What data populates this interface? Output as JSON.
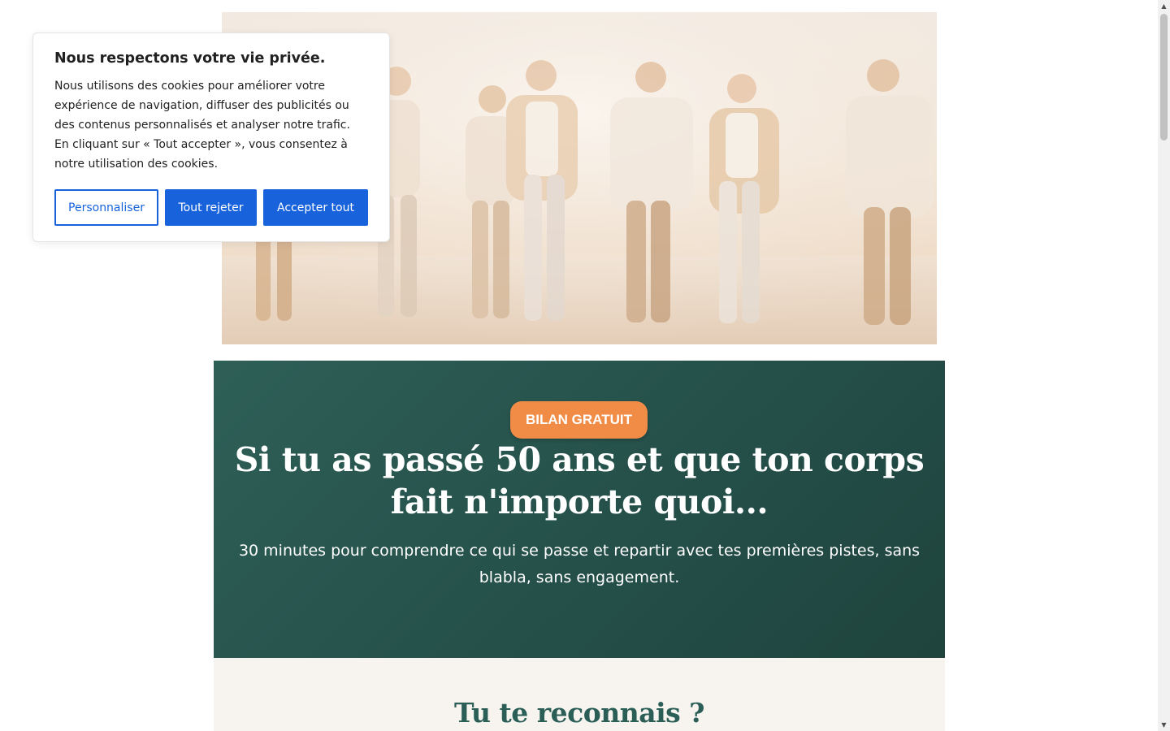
{
  "cookie_banner": {
    "title": "Nous respectons votre vie privée.",
    "text": "Nous utilisons des cookies pour améliorer votre expérience de navigation, diffuser des publicités ou des contenus personnalisés et analyser notre trafic. En cliquant sur « Tout accepter », vous consentez à notre utilisation des cookies.",
    "customize_label": "Personnaliser",
    "reject_label": "Tout rejeter",
    "accept_label": "Accepter tout"
  },
  "hero": {
    "image_description_icon": "photo-group-of-seniors-walking"
  },
  "banner": {
    "badge": "BILAN GRATUIT",
    "headline": "Si tu as passé 50 ans et que ton corps fait n'importe quoi...",
    "subline": "30 minutes pour comprendre ce qui se passe et repartir avec tes premières pistes, sans blabla, sans engagement."
  },
  "section2": {
    "title": "Tu te reconnais ?"
  },
  "scrollbar": {
    "up_icon": "▲",
    "down_icon": "▼"
  },
  "colors": {
    "banner_green": "#2b5a53",
    "badge_orange": "#f08c45",
    "button_blue": "#1863dc",
    "section_title_green": "#2b5e57"
  }
}
